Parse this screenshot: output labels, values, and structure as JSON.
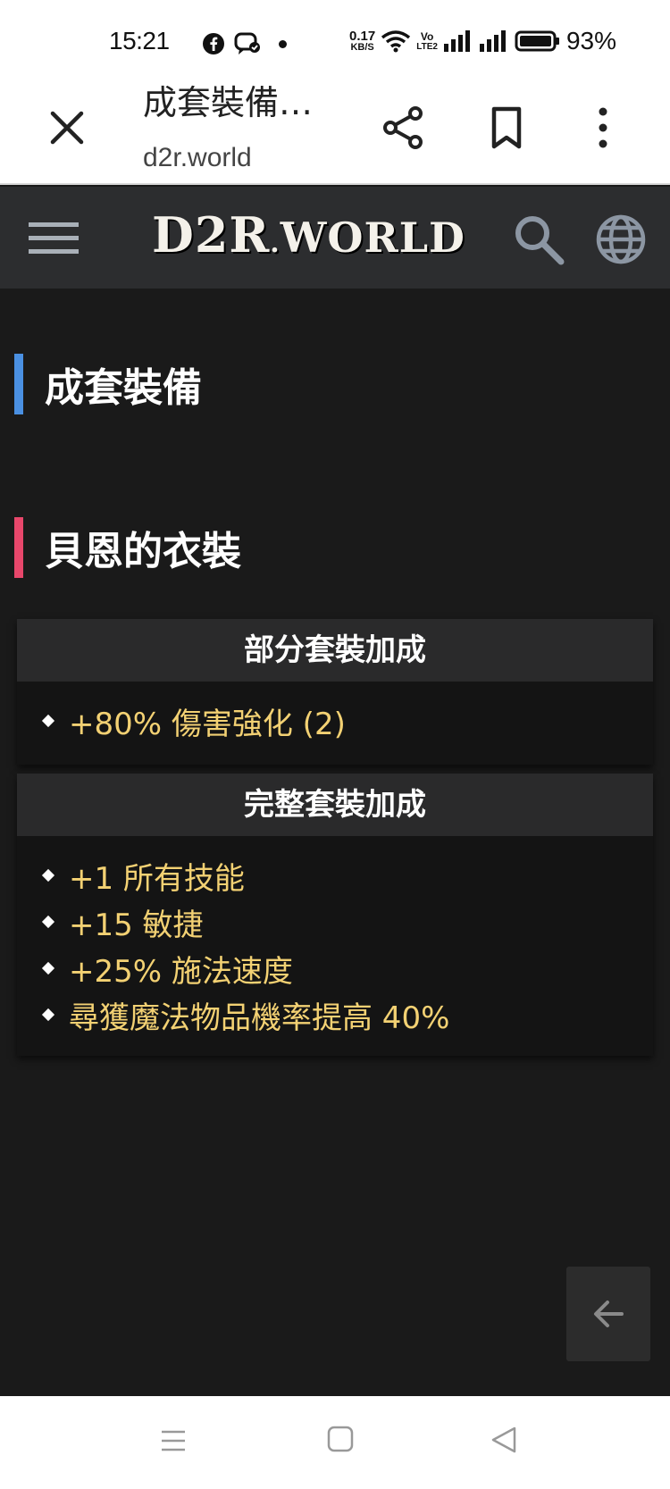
{
  "status_bar": {
    "time": "15:21",
    "net_speed_value": "0.17",
    "net_speed_unit": "KB/S",
    "volte_label": "Vo",
    "volte_sub": "LTE2",
    "battery_percent": "93%"
  },
  "toolbar": {
    "page_title": "成套裝備…",
    "url": "d2r.world"
  },
  "site_header": {
    "logo_text_main": "D2R",
    "logo_text_dot": ".",
    "logo_text_world": "WORLD"
  },
  "page": {
    "title": "成套裝備",
    "set_name": "貝恩的衣裝"
  },
  "partial_bonus": {
    "heading": "部分套裝加成",
    "items": [
      "+80% 傷害強化 (2)"
    ]
  },
  "full_bonus": {
    "heading": "完整套裝加成",
    "items": [
      "+1 所有技能",
      "+15 敏捷",
      "+25% 施法速度",
      "尋獲魔法物品機率提高 40%"
    ]
  },
  "colors": {
    "title_accent": "#4a90e2",
    "set_accent": "#e8476b",
    "bonus_text": "#f3d173",
    "page_bg": "#1a1a1a",
    "header_bg": "#2c2d2f"
  },
  "icons": {
    "close": "close-icon",
    "share": "share-icon",
    "bookmark": "bookmark-icon",
    "more": "more-vert-icon",
    "menu": "hamburger-icon",
    "search": "search-icon",
    "language": "globe-icon",
    "back_to_top": "arrow-left-icon"
  }
}
